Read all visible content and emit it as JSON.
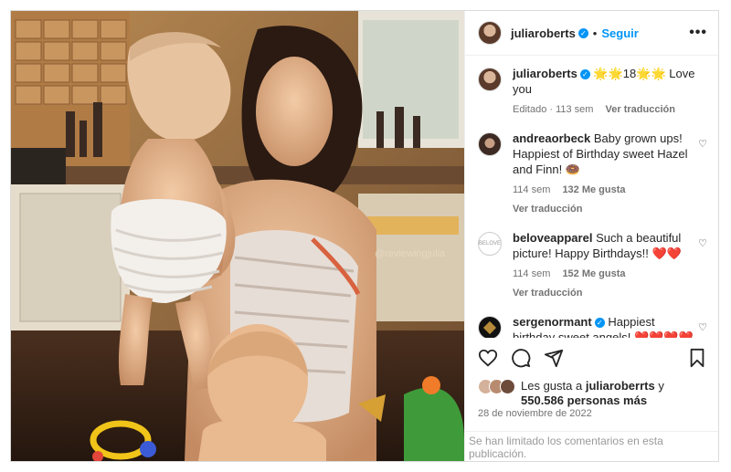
{
  "photo": {
    "watermark": "@reviewingjulia"
  },
  "header": {
    "username": "juliaroberts",
    "separator": "•",
    "follow_label": "Seguir",
    "more_label": "•••"
  },
  "caption": {
    "username": "juliaroberts",
    "text": "🌟🌟18🌟🌟 Love you",
    "edited": "Editado · 113 sem",
    "translate": "Ver traducción"
  },
  "comments": [
    {
      "username": "andreaorbeck",
      "text": "Baby grown ups! Happiest of Birthday sweet Hazel and Finn! 🍩",
      "time": "114 sem",
      "likes": "132 Me gusta",
      "translate": "Ver traducción"
    },
    {
      "username": "beloveapparel",
      "text": "Such a beautiful picture! Happy Birthdays!! ❤️❤️",
      "time": "114 sem",
      "likes": "152 Me gusta",
      "translate": "Ver traducción"
    },
    {
      "username": "sergenormant",
      "text": "Happiest birthday sweet angels! ❤️❤️❤️❤️❤️"
    }
  ],
  "likes": {
    "prefix": "Les gusta a",
    "user": "juliaroberrts",
    "connector": "y",
    "count": "550.586",
    "suffix": "personas más"
  },
  "date": "28 de noviembre de 2022",
  "comments_limited": "Se han limitado los comentarios en esta publicación.",
  "icons": [
    "heart-icon",
    "comment-icon",
    "share-icon",
    "bookmark-icon",
    "more-icon",
    "verified-icon"
  ],
  "colors": {
    "link": "#0095f6",
    "verified": "#0095f6",
    "text": "#262626",
    "muted": "#737373"
  }
}
